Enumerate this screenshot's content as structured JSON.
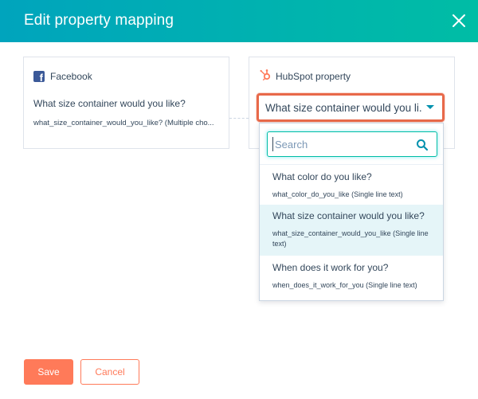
{
  "dialog": {
    "title": "Edit property mapping",
    "close_icon": "close-icon"
  },
  "facebook_card": {
    "source_name": "Facebook",
    "source_icon": "facebook-icon",
    "question": "What size container would you like?",
    "internal_name": "what_size_container_would_you_like? (Multiple cho..."
  },
  "hubspot_card": {
    "target_name": "HubSpot property",
    "target_icon": "hubspot-sprocket-icon",
    "selected_value": "What size container would you li...",
    "search_placeholder": "Search",
    "options": [
      {
        "label": "What color do you like?",
        "meta": "what_color_do_you_like (Single line text)"
      },
      {
        "label": "What size container would you like?",
        "meta": "what_size_container_would_you_like (Single line text)",
        "highlighted": true
      },
      {
        "label": "When does it work for you?",
        "meta": "when_does_it_work_for_you (Single line text)"
      }
    ]
  },
  "footer": {
    "save_label": "Save",
    "cancel_label": "Cancel"
  },
  "colors": {
    "header_gradient_start": "#00a4bd",
    "header_gradient_end": "#00bda5",
    "accent_orange": "#ff7a59",
    "focus_ring": "#e8694a",
    "facebook_blue": "#3b5998",
    "highlight_row": "#e5f5f8"
  }
}
